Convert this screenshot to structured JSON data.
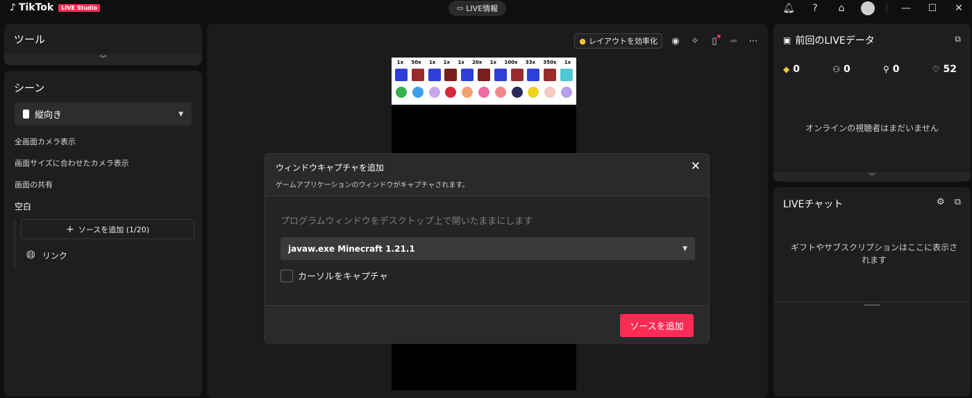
{
  "app": {
    "logo_text": "TikTok",
    "studio_badge": "LIVE Studio",
    "live_info_label": "LIVE情報"
  },
  "left": {
    "tools_title": "ツール",
    "scenes_title": "シーン",
    "scene_select": "縦向き",
    "scene_items": [
      "全画面カメラ表示",
      "画面サイズに合わせたカメラ表示",
      "画面の共有",
      "空白"
    ],
    "add_source_label": "ソースを追加 (1/20)",
    "source_link_label": "リンク"
  },
  "center": {
    "layout_button": "レイアウトを効率化",
    "overlay_multipliers": [
      "1x",
      "50x",
      "1x",
      "1x",
      "1x",
      "20x",
      "1x",
      "100x",
      "33x",
      "350x",
      "1x"
    ]
  },
  "modal": {
    "title": "ウィンドウキャプチャを追加",
    "subtitle": "ゲームアプリケーションのウィンドウがキャプチャされます。",
    "hint": "プログラムウィンドウをデスクトップ上で開いたままにします",
    "window_select": "javaw.exe Minecraft 1.21.1",
    "capture_cursor_label": "カーソルをキャプチャ",
    "submit_label": "ソースを追加"
  },
  "right": {
    "prev_live_title": "前回のLIVEデータ",
    "stats": {
      "diamonds": "0",
      "viewers": "0",
      "followers": "0",
      "likes": "52"
    },
    "no_viewers": "オンラインの視聴者はまだいません",
    "chat_title": "LIVEチャット",
    "chat_empty": "ギフトやサブスクリプションはここに表示されます"
  },
  "colors": {
    "accent": "#fe2c55",
    "panel": "#1e1e20",
    "background": "#0f0f10"
  }
}
